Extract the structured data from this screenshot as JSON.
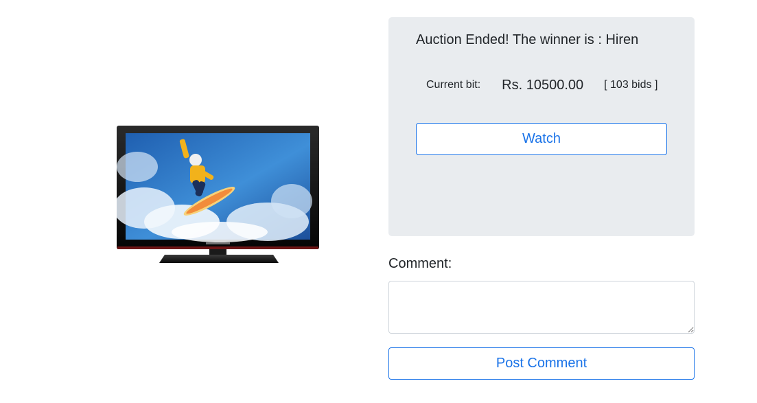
{
  "product": {
    "image_icon": "television-icon"
  },
  "auction": {
    "winner_text": "Auction Ended! The winner is : Hiren",
    "current_bid_label": "Current bit:",
    "current_bid_amount": "Rs. 10500.00",
    "bid_count": "[ 103 bids ]",
    "watch_label": "Watch",
    "accent_color": "#1a73e8",
    "panel_color": "#e9ecef"
  },
  "comment": {
    "label": "Comment:",
    "value": "",
    "placeholder": "",
    "post_label": "Post Comment"
  }
}
